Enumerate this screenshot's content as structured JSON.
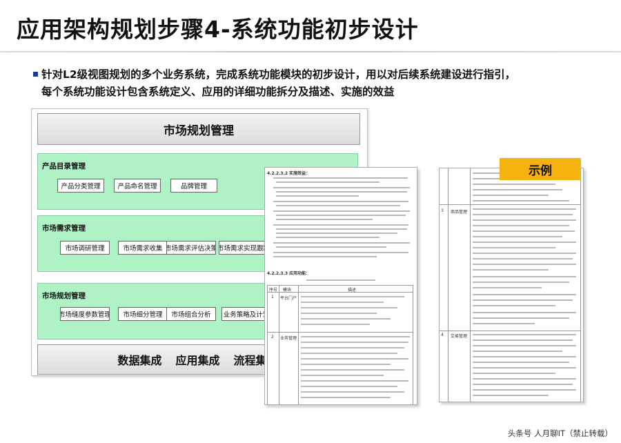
{
  "page": {
    "title": "应用架构规划步骤4-系统功能初步设计"
  },
  "bullet": {
    "line1": "针对L2级视图规划的多个业务系统，完成系统功能模块的初步设计，用以对后续系统建设进行指引，",
    "line2": "每个系统功能设计包含系统定义、应用的详细功能拆分及描述、实施的效益"
  },
  "diagram": {
    "header": "市场规划管理",
    "groups": [
      {
        "title": "产品目录管理",
        "items": [
          "产品分类管理",
          "产品命名管理",
          "品牌管理"
        ]
      },
      {
        "title": "市场需求管理",
        "items": [
          "市场调研管理",
          "市场需求收集",
          "市场需求评估决策",
          "市场需求实现跟踪"
        ]
      },
      {
        "title": "市场规划管理",
        "items": [
          "市场缝度参数管理",
          "市场细分管理",
          "市场组合分析",
          "业务策略及计划"
        ]
      }
    ],
    "bottom_items": [
      "数据集成",
      "应用集成",
      "流程集成"
    ]
  },
  "docs": {
    "left_heading_1": "4.2.2.3.2 实施效益：",
    "left_heading_2": "4.2.2.3.3 应用功能：",
    "left_table_cols": [
      "序号",
      "模块",
      "描述"
    ],
    "left_table_rows": [
      {
        "no": "1",
        "module": "平台门户"
      },
      {
        "no": "2",
        "module": "业务管理"
      }
    ],
    "right_table_rows": [
      {
        "no": "3",
        "module": "商品管理"
      },
      {
        "no": "4",
        "module": "交易管理"
      }
    ]
  },
  "badge": {
    "label": "示例"
  },
  "footer": {
    "text": "头条号 人月聊IT（禁止转载）"
  },
  "colors": {
    "group_fill": "#aef2c6",
    "badge": "#f6b20c",
    "bullet_mark": "#1f3a8a"
  }
}
